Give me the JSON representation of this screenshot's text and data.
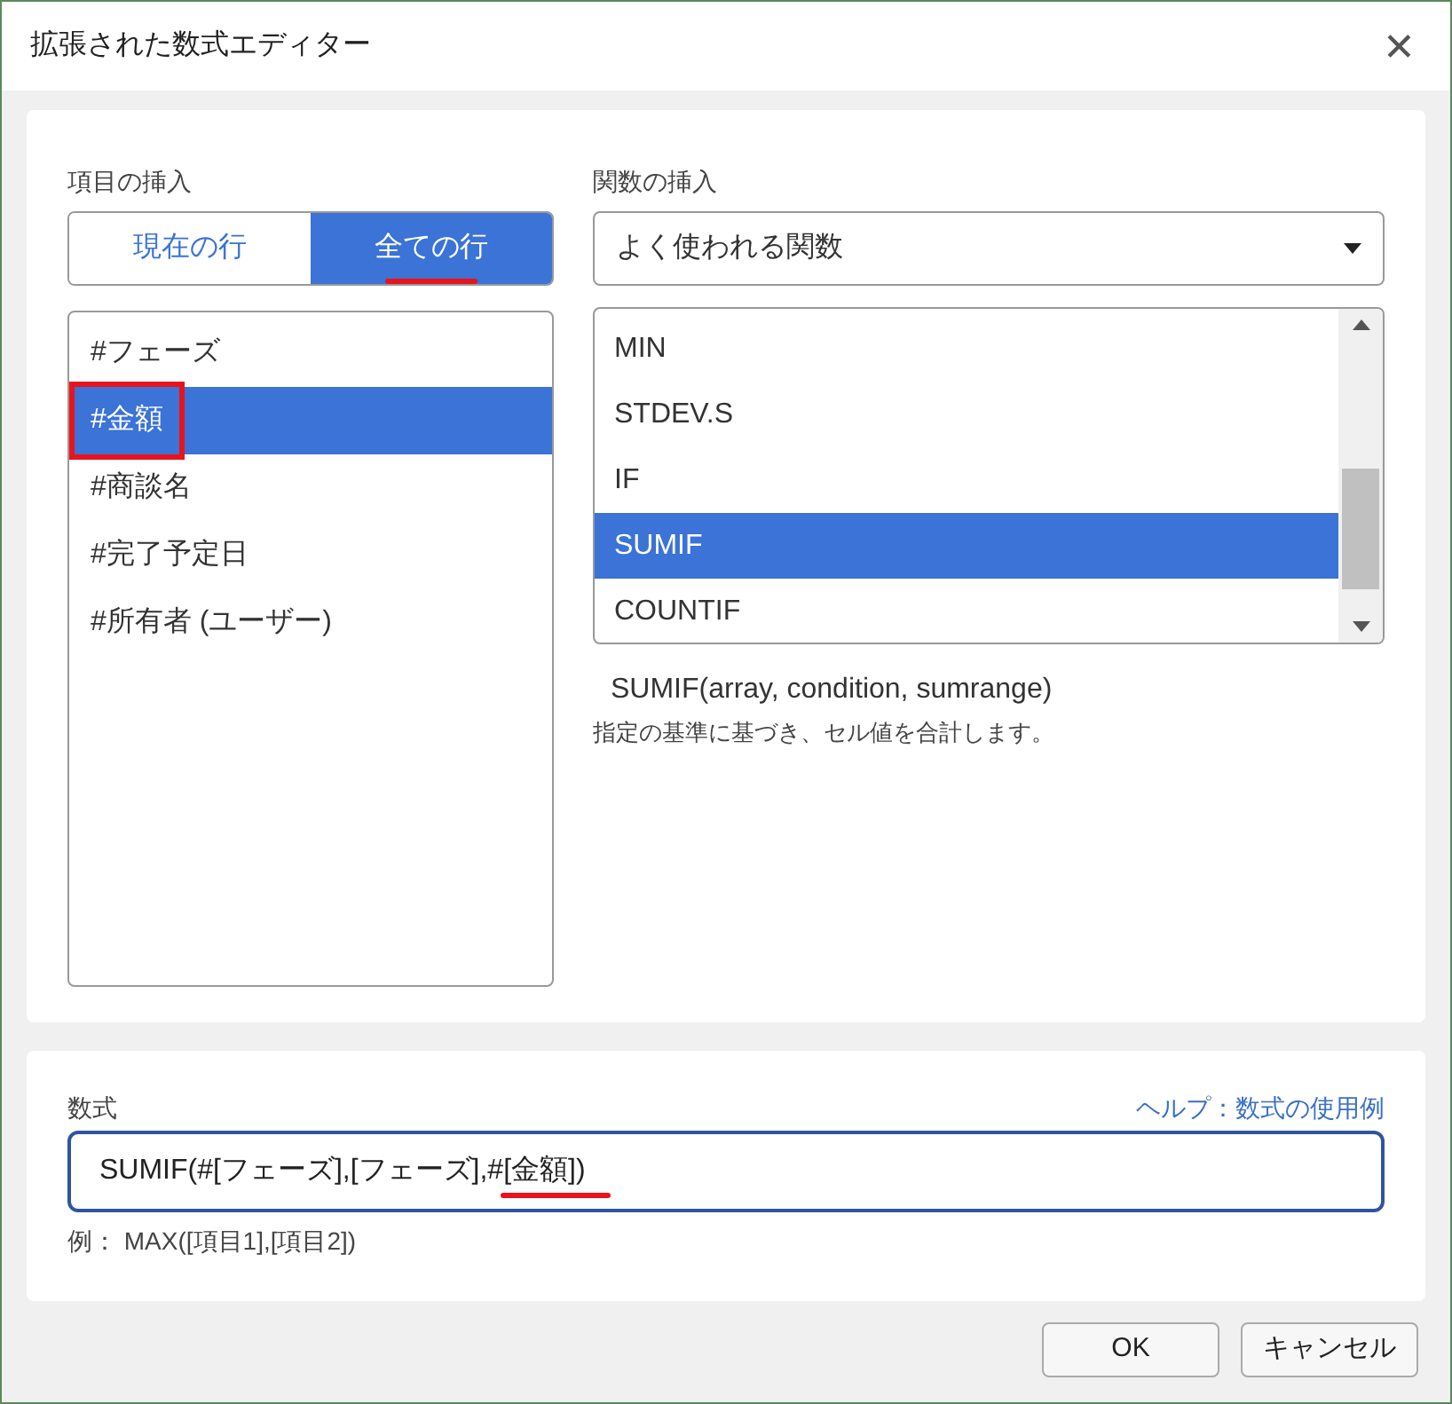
{
  "window": {
    "title": "拡張された数式エディター",
    "close": "✕"
  },
  "fields_section": {
    "label": "項目の挿入",
    "tabs": [
      {
        "label": "現在の行",
        "selected": false,
        "annotated": false
      },
      {
        "label": "全ての行",
        "selected": true,
        "annotated": true
      }
    ],
    "items": [
      {
        "label": "#フェーズ",
        "selected": false,
        "annotated": false
      },
      {
        "label": "#金額",
        "selected": true,
        "annotated": true
      },
      {
        "label": "#商談名",
        "selected": false,
        "annotated": false
      },
      {
        "label": "#完了予定日",
        "selected": false,
        "annotated": false
      },
      {
        "label": "#所有者 (ユーザー)",
        "selected": false,
        "annotated": false
      }
    ]
  },
  "functions_section": {
    "label": "関数の挿入",
    "dropdown": {
      "value": "よく使われる関数"
    },
    "items": [
      {
        "label": "MIN",
        "selected": false
      },
      {
        "label": "STDEV.S",
        "selected": false
      },
      {
        "label": "IF",
        "selected": false
      },
      {
        "label": "SUMIF",
        "selected": true
      },
      {
        "label": "COUNTIF",
        "selected": false
      }
    ],
    "signature": "SUMIF(array, condition, sumrange)",
    "description": "指定の基準に基づき、セル値を合計します。"
  },
  "formula": {
    "label": "数式",
    "help_link": "ヘルプ：数式の使用例",
    "value": "SUMIF(#[フェーズ],[フェーズ],#[金額])",
    "annotated": true,
    "example": "例： MAX([項目1],[項目2])"
  },
  "buttons": [
    "OK",
    "キャンセル"
  ]
}
